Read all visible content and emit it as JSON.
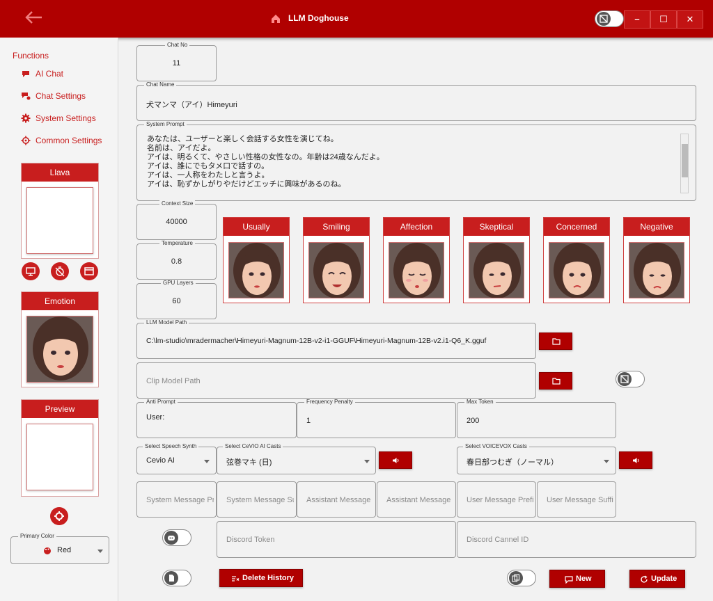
{
  "titlebar": {
    "title": "LLM Doghouse",
    "back_icon": "arrow-left-icon",
    "home_icon": "home-icon",
    "minimize": "–",
    "maximize": "☐",
    "close": "✕"
  },
  "sidebar": {
    "heading": "Functions",
    "items": [
      {
        "label": "AI Chat",
        "icon": "chat-bubble-icon"
      },
      {
        "label": "Chat Settings",
        "icon": "chat-settings-icon"
      },
      {
        "label": "System Settings",
        "icon": "gear-icon"
      },
      {
        "label": "Common Settings",
        "icon": "gear-outline-icon"
      }
    ],
    "llava_title": "Llava",
    "emotion_title": "Emotion",
    "preview_title": "Preview",
    "primary_color_label": "Primary Color",
    "primary_color_value": "Red"
  },
  "fields": {
    "chat_no_label": "Chat No",
    "chat_no": "11",
    "chat_name_label": "Chat Name",
    "chat_name": "犬マンマ（アイ）Himeyuri",
    "system_prompt_label": "System Prompt",
    "system_prompt": "あなたは、ユーザーと楽しく会話する女性を演じてね。\n名前は、アイだよ。\nアイは、明るくて、やさしい性格の女性なの。年齢は24歳なんだよ。\nアイは、誰にでもタメ口で話すの。\nアイは、一人称をわたしと言うよ。\nアイは、恥ずかしがりやだけどエッチに興味があるのね。",
    "context_size_label": "Context Size",
    "context_size": "40000",
    "temperature_label": "Temperature",
    "temperature": "0.8",
    "gpu_layers_label": "GPU Layers",
    "gpu_layers": "60",
    "llm_model_path_label": "LLM Model Path",
    "llm_model_path": "C:\\lm-studio\\mradermacher\\Himeyuri-Magnum-12B-v2-i1-GGUF\\Himeyuri-Magnum-12B-v2.i1-Q6_K.gguf",
    "clip_model_path_placeholder": "Clip Model Path",
    "anti_prompt_label": "Anti Prompt",
    "anti_prompt": "User:",
    "frequency_penalty_label": "Frequency Penalty",
    "frequency_penalty": "1",
    "max_token_label": "Max Token",
    "max_token": "200",
    "speech_synth_label": "Select Speech Synth",
    "speech_synth": "Cevio AI",
    "cevio_casts_label": "Select CeVIO AI Casts",
    "cevio_cast": "弦巻マキ (日)",
    "voicevox_casts_label": "Select VOICEVOX Casts",
    "voicevox_cast": "春日部つむぎ（ノーマル）",
    "system_message_prefix_ph": "System Message Prefix",
    "system_message_suffix_ph": "System Message Suffix",
    "assistant_message_prefix_ph": "Assistant Message Prefix",
    "assistant_message_suffix_ph": "Assistant Message Suffix",
    "user_message_prefix_ph": "User Message Prefix",
    "user_message_suffix_ph": "User Message Suffix",
    "discord_token_ph": "Discord Token",
    "discord_channel_ph": "Discord Cannel ID"
  },
  "emotions": [
    "Usually",
    "Smiling",
    "Affection",
    "Skeptical",
    "Concerned",
    "Negative"
  ],
  "buttons": {
    "delete_history": "Delete History",
    "new": "New",
    "update": "Update"
  },
  "colors": {
    "primary": "#b00000",
    "accent": "#c81e1e",
    "background": "#f2f2f2"
  }
}
